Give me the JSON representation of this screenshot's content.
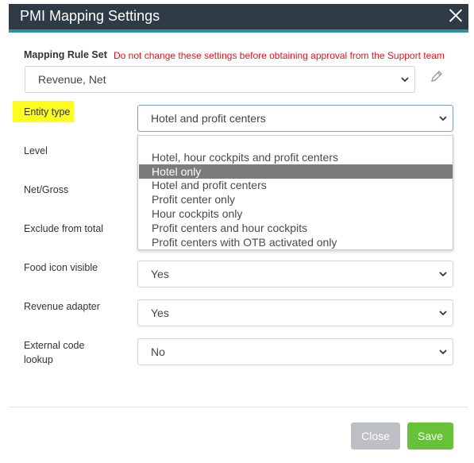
{
  "dialog": {
    "title": "PMI Mapping Settings"
  },
  "mapping_rule": {
    "label": "Mapping Rule Set",
    "warning": "Do not change these settings before obtaining approval from the Support team",
    "value": "Revenue, Net"
  },
  "fields": {
    "entity_type": {
      "label": "Entity type",
      "value": "Hotel and profit centers"
    },
    "level": {
      "label": "Level"
    },
    "net_gross": {
      "label": "Net/Gross"
    },
    "exclude_from_total": {
      "label": "Exclude from total"
    },
    "food_icon_visible": {
      "label": "Food icon visible",
      "value": "Yes"
    },
    "revenue_adapter": {
      "label": "Revenue adapter",
      "value": "Yes"
    },
    "external_code_lookup": {
      "label_line1": "External code",
      "label_line2": "lookup",
      "value": "No"
    }
  },
  "entity_type_options": [
    "",
    "Hotel, hour cockpits and profit centers",
    "Hotel only",
    "Hotel and profit centers",
    "Profit center only",
    "Hour cockpits only",
    "Profit centers and hour cockpits",
    "Profit centers with OTB activated only"
  ],
  "entity_type_highlighted_index": 2,
  "footer": {
    "close_label": "Close",
    "save_label": "Save"
  },
  "colors": {
    "header": "#2f3a47",
    "header_accent": "#2f8f9d",
    "warning": "#e0141e",
    "highlight": "#fcfc1f",
    "selected_option": "#7c7c7c",
    "close_button": "#bcbfc4",
    "save_button": "#67c23a"
  }
}
